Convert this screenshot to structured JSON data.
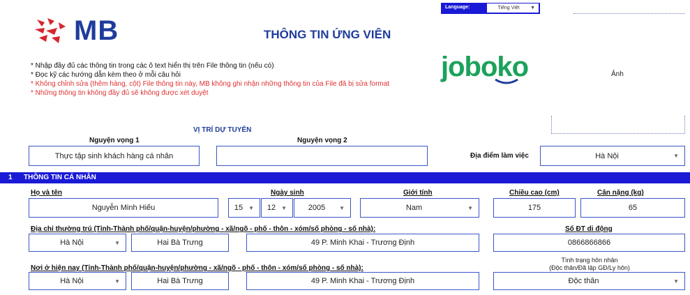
{
  "header": {
    "brand": "MB",
    "title": "THÔNG TIN ỨNG VIÊN",
    "language_label": "Language:",
    "language_value": "Tiếng Việt",
    "partner_logo": "joboko",
    "photo_label": "Ảnh"
  },
  "notes": [
    "* Nhập đầy đủ các thông tin trong các ô text hiển thị trên File thông tin (nếu có)",
    "* Đọc kỹ các hướng dẫn kèm theo ở mỗi câu hỏi",
    "* Không chỉnh sửa (thêm hàng, cột) File thông tin này, MB không ghi nhận những thông tin của File đã bị sửa format",
    "* Những thông tin không đầy đủ sẽ không được xét duyệt"
  ],
  "colors": {
    "brand_red": "#d6262f",
    "brand_blue": "#1f3c9c",
    "section_bar": "#1a1ad6",
    "note_red": "#e03030",
    "joboko_green": "#1aa35a"
  },
  "position": {
    "heading": "VỊ TRÍ DỰ TUYỂN",
    "choice1_label": "Nguyện vọng 1",
    "choice1_value": "Thực tập sinh khách hàng cá nhân",
    "choice2_label": "Nguyện vọng 2",
    "choice2_value": "",
    "workplace_label": "Địa điểm làm việc",
    "workplace_value": "Hà Nội"
  },
  "section1": {
    "number": "1",
    "title": "THÔNG TIN CÁ NHÂN",
    "fullname_label": "Họ và tên",
    "fullname_value": "Nguyễn Minh Hiếu",
    "dob_label": "Ngày sinh",
    "dob_day": "15",
    "dob_month": "12",
    "dob_year": "2005",
    "gender_label": "Giới tính",
    "gender_value": "Nam",
    "height_label": "Chiều cao (cm)",
    "height_value": "175",
    "weight_label": "Cân nặng (kg)",
    "weight_value": "65",
    "permanent_label": "Địa chỉ thường trú (Tỉnh-Thành phố/quận-huyện/phường - xã/ngõ - phố - thôn - xóm/số phòng - số nhà):",
    "permanent_province": "Hà Nội",
    "permanent_district": "Hai Bà Trưng",
    "permanent_street": "49 P. Minh Khai - Trương Định",
    "phone_label": "Số ĐT di động",
    "phone_value": "0866866866",
    "current_label": "Nơi ở hiện nay (Tỉnh-Thành phố/quận-huyện/phường - xã/ngõ - phố - thôn - xóm/số phòng - số nhà):",
    "current_province": "Hà Nội",
    "current_district": "Hai Bà Trưng",
    "current_street": "49 P. Minh Khai - Trương Định",
    "marital_label_1": "Tình trạng hôn nhân",
    "marital_label_2": "(Độc thân/Đã lập GĐ/Ly hôn)",
    "marital_value": "Độc thân"
  }
}
